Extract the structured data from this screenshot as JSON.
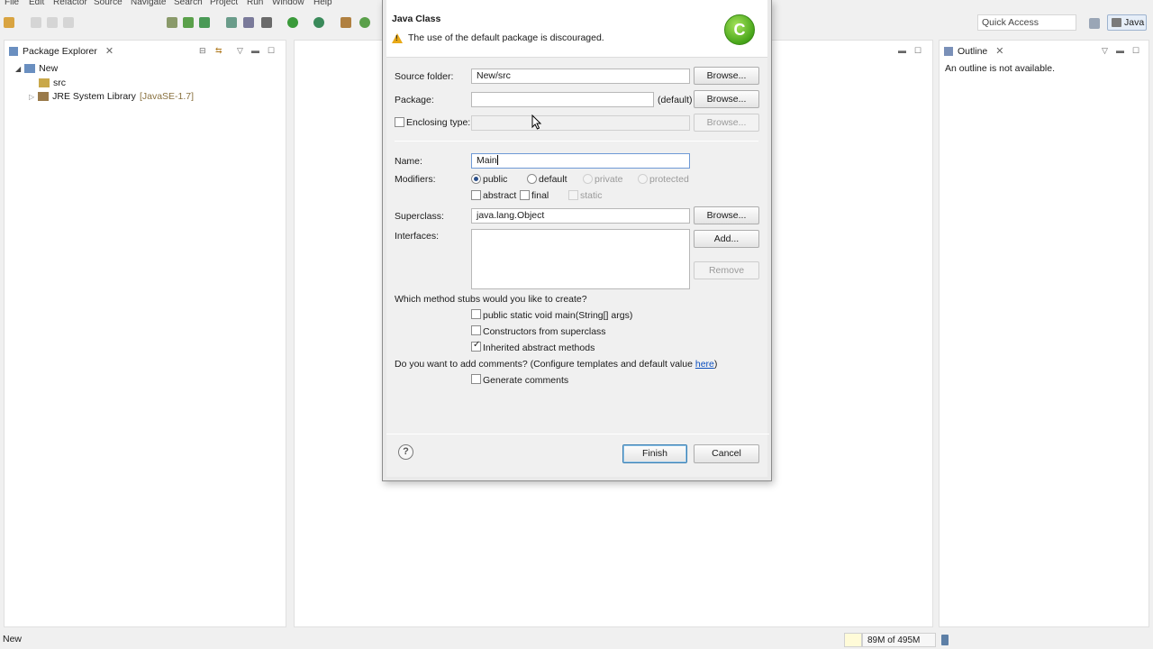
{
  "menu": [
    "File",
    "Edit",
    "Refactor",
    "Source",
    "Navigate",
    "Search",
    "Project",
    "Run",
    "Window",
    "Help"
  ],
  "toolbar": {
    "quick_access_placeholder": "Quick Access",
    "perspective_label": "Java"
  },
  "package_explorer": {
    "title": "Package Explorer",
    "tree": {
      "project": "New",
      "src": "src",
      "library": "JRE System Library",
      "library_suffix": "[JavaSE-1.7]"
    }
  },
  "outline": {
    "title": "Outline",
    "message": "An outline is not available."
  },
  "dialog": {
    "title": "Java Class",
    "message": "The use of the default package is discouraged.",
    "source_folder_label": "Source folder:",
    "source_folder_value": "New/src",
    "package_label": "Package:",
    "package_value": "",
    "package_default": "(default)",
    "enclosing_label": "Enclosing type:",
    "browse_label": "Browse...",
    "name_label": "Name:",
    "name_value": "Main",
    "modifiers_label": "Modifiers:",
    "modifiers": {
      "public": "public",
      "default": "default",
      "private": "private",
      "protected": "protected",
      "abstract": "abstract",
      "final": "final",
      "static": "static"
    },
    "superclass_label": "Superclass:",
    "superclass_value": "java.lang.Object",
    "interfaces_label": "Interfaces:",
    "add_label": "Add...",
    "remove_label": "Remove",
    "stubs_question": "Which method stubs would you like to create?",
    "stubs": {
      "main": "public static void main(String[] args)",
      "constructors": "Constructors from superclass",
      "inherited": "Inherited abstract methods"
    },
    "comments_question": "Do you want to add comments? (Configure templates and default value ",
    "comments_link": "here",
    "comments_close": ")",
    "generate_comments": "Generate comments",
    "finish_label": "Finish",
    "cancel_label": "Cancel"
  },
  "status": {
    "left_text": "New",
    "memory": "89M of 495M"
  }
}
